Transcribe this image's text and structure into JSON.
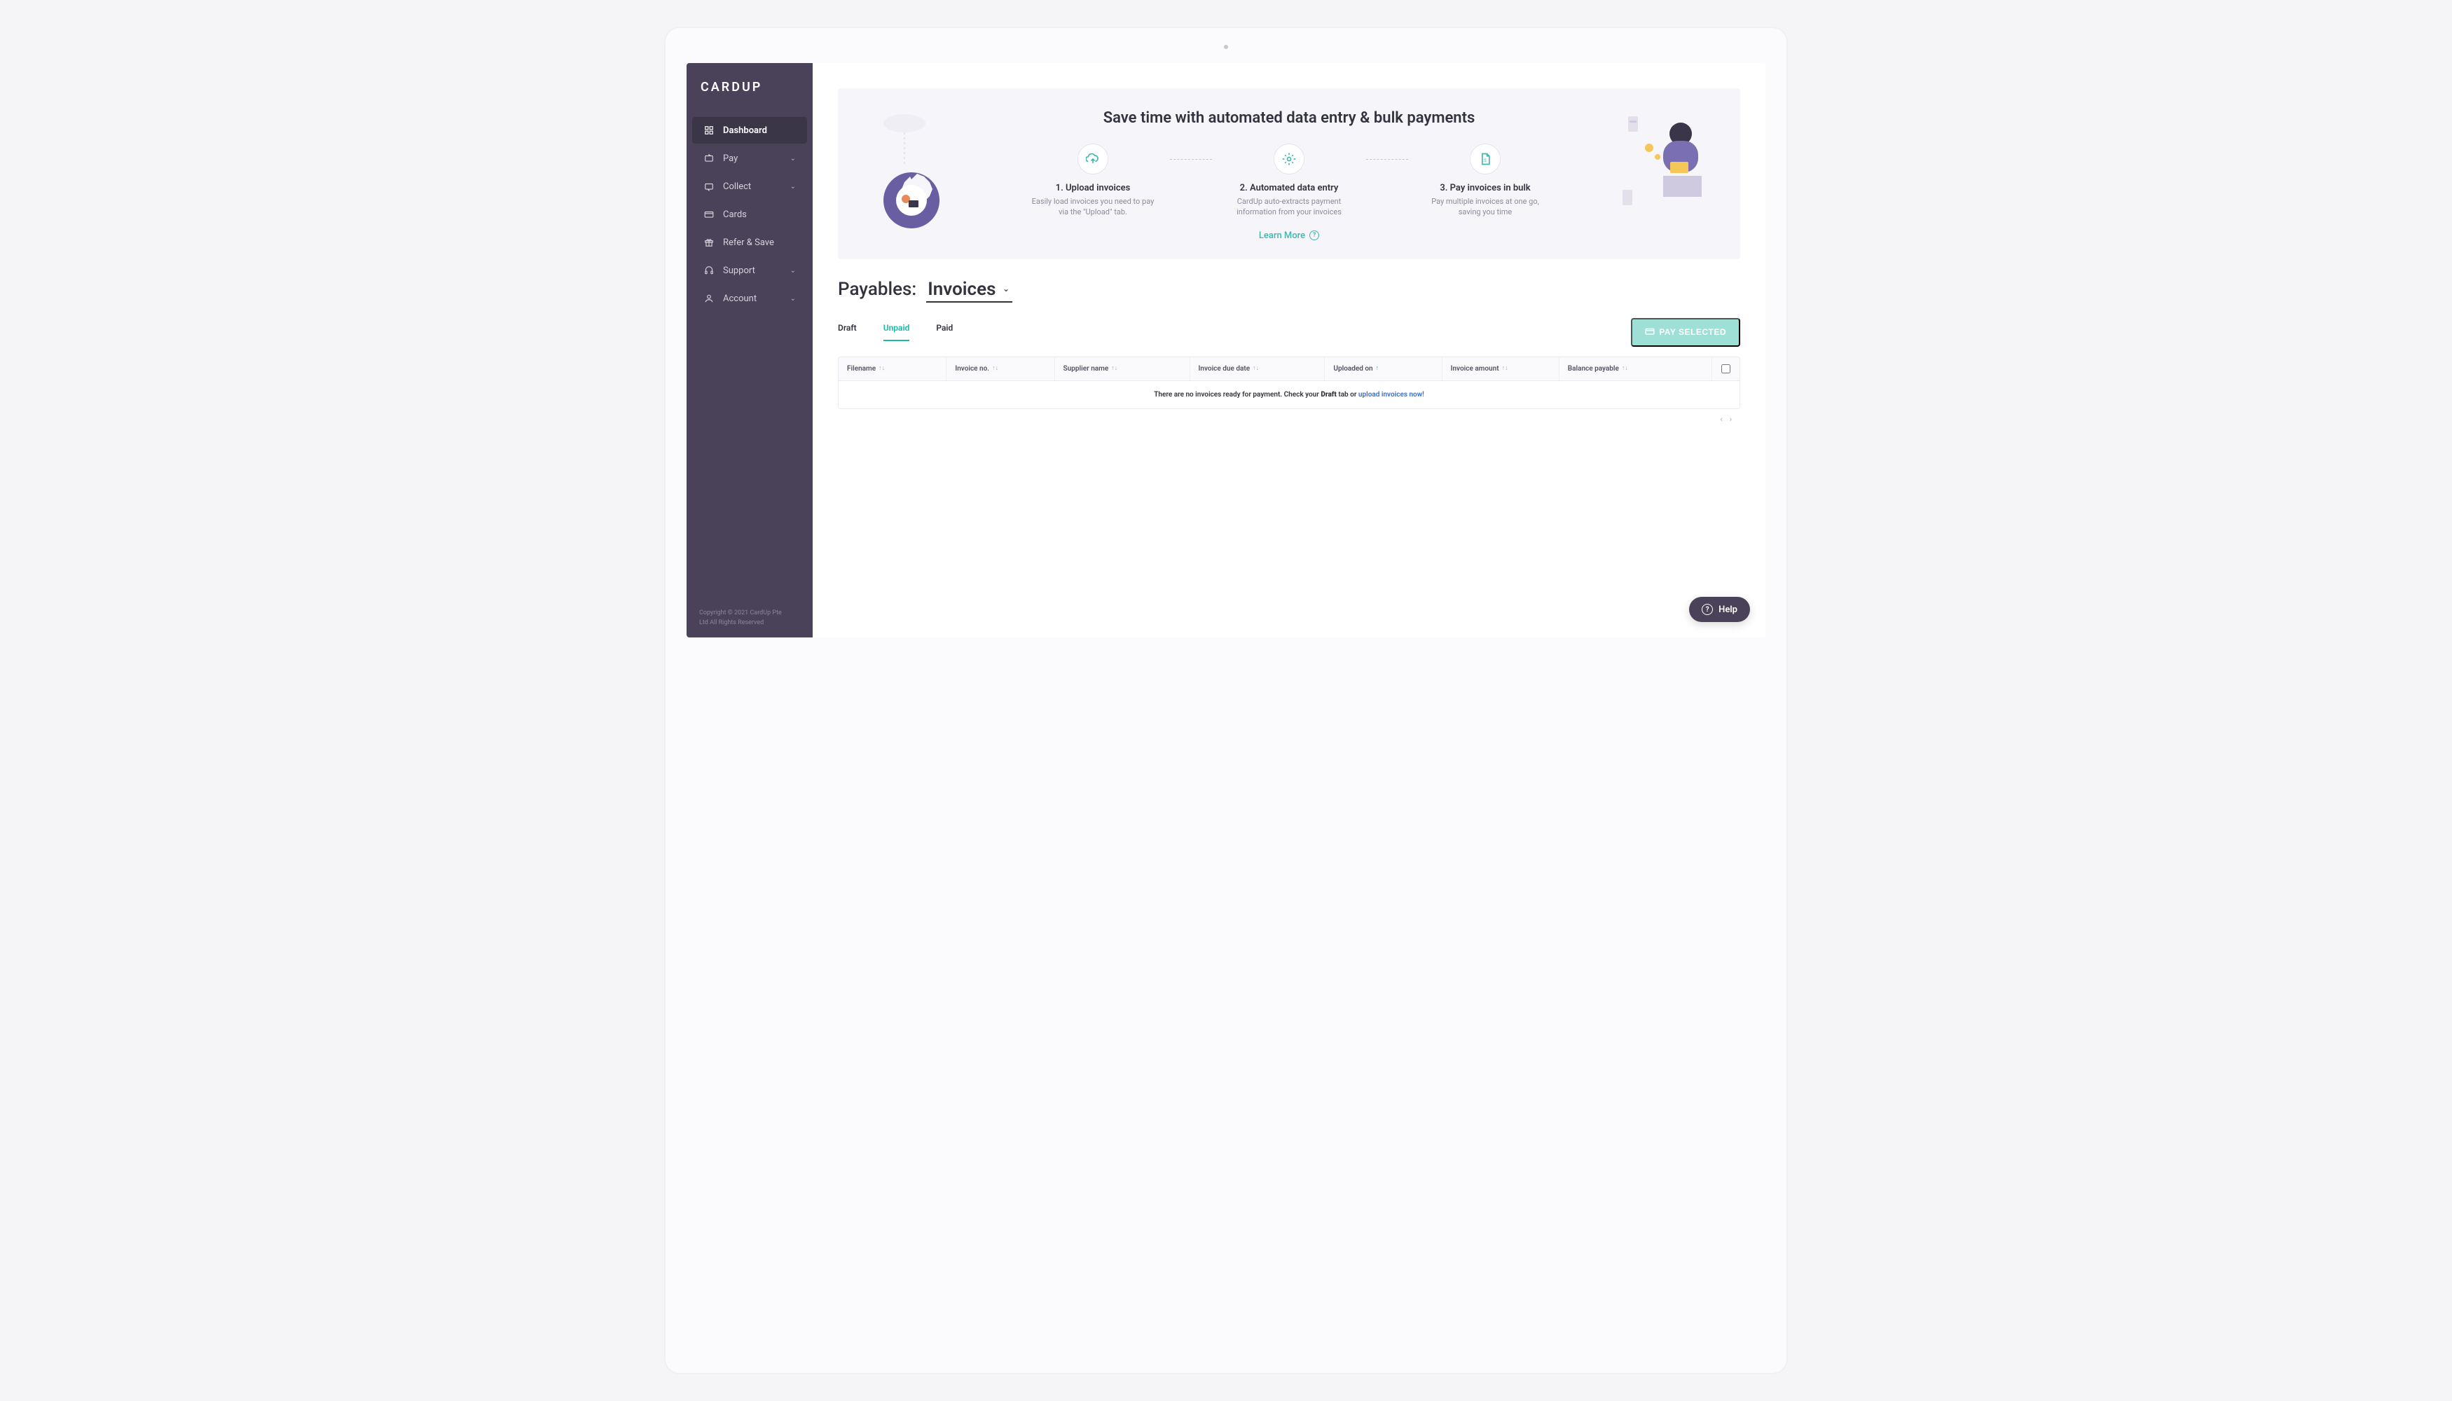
{
  "brand": "CARDUP",
  "sidebar": {
    "items": [
      {
        "label": "Dashboard",
        "icon": "dashboard-icon",
        "expandable": false,
        "active": true
      },
      {
        "label": "Pay",
        "icon": "pay-icon",
        "expandable": true
      },
      {
        "label": "Collect",
        "icon": "collect-icon",
        "expandable": true
      },
      {
        "label": "Cards",
        "icon": "cards-icon",
        "expandable": false
      },
      {
        "label": "Refer & Save",
        "icon": "gift-icon",
        "expandable": false
      },
      {
        "label": "Support",
        "icon": "support-icon",
        "expandable": true
      },
      {
        "label": "Account",
        "icon": "account-icon",
        "expandable": true
      }
    ],
    "footer_line1": "Copyright © 2021 CardUp Pte",
    "footer_line2": "Ltd All Rights Reserved"
  },
  "hero": {
    "title": "Save time with automated data entry & bulk payments",
    "steps": [
      {
        "title": "1. Upload invoices",
        "desc": "Easily load invoices you need to pay via the \"Upload\" tab."
      },
      {
        "title": "2. Automated data entry",
        "desc": "CardUp auto-extracts payment information from your invoices"
      },
      {
        "title": "3. Pay invoices in bulk",
        "desc": "Pay multiple invoices at one go, saving you time"
      }
    ],
    "learn_more": "Learn More"
  },
  "payables": {
    "label": "Payables:",
    "selected": "Invoices"
  },
  "tabs": {
    "items": [
      "Draft",
      "Unpaid",
      "Paid"
    ],
    "active": "Unpaid"
  },
  "action_button": "PAY SELECTED",
  "table": {
    "headers": [
      "Filename",
      "Invoice no.",
      "Supplier name",
      "Invoice due date",
      "Uploaded on",
      "Invoice amount",
      "Balance payable"
    ],
    "empty_prefix": "There are no invoices ready for payment. Check your ",
    "empty_bold": "Draft",
    "empty_mid": " tab or ",
    "empty_link": "upload invoices now!"
  },
  "help_label": "Help"
}
